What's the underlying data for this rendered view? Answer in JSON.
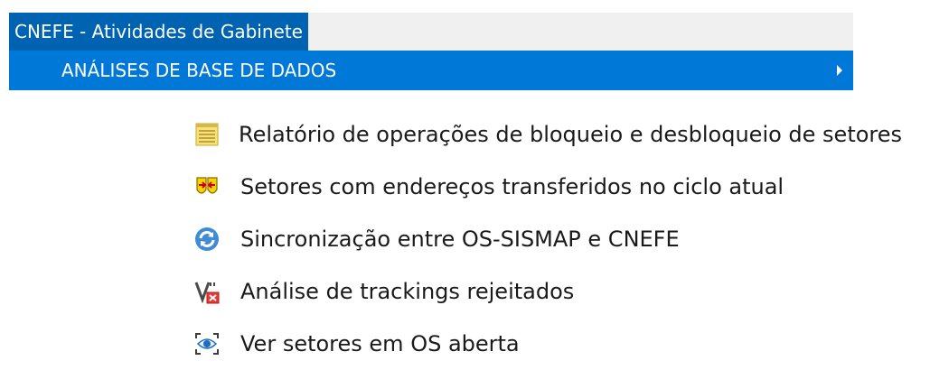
{
  "menu": {
    "title": "CNEFE - Atividades de Gabinete"
  },
  "submenu": {
    "label": "ANÁLISES DE BASE DE DADOS"
  },
  "flyout": {
    "items": [
      {
        "label": "Relatório de operações de bloqueio e desbloqueio de setores",
        "icon": "notepad-icon"
      },
      {
        "label": "Setores com endereços transferidos no ciclo atual",
        "icon": "transfer-icon"
      },
      {
        "label": "Sincronização entre OS-SISMAP e CNEFE",
        "icon": "sync-icon"
      },
      {
        "label": "Análise de trackings rejeitados",
        "icon": "tracking-rejected-icon"
      },
      {
        "label": "Ver setores em OS aberta",
        "icon": "eye-icon"
      }
    ]
  },
  "colors": {
    "menu_title_bg": "#0063b1",
    "submenu_highlight": "#0078d7",
    "menubar_bg": "#f0f0f0"
  }
}
